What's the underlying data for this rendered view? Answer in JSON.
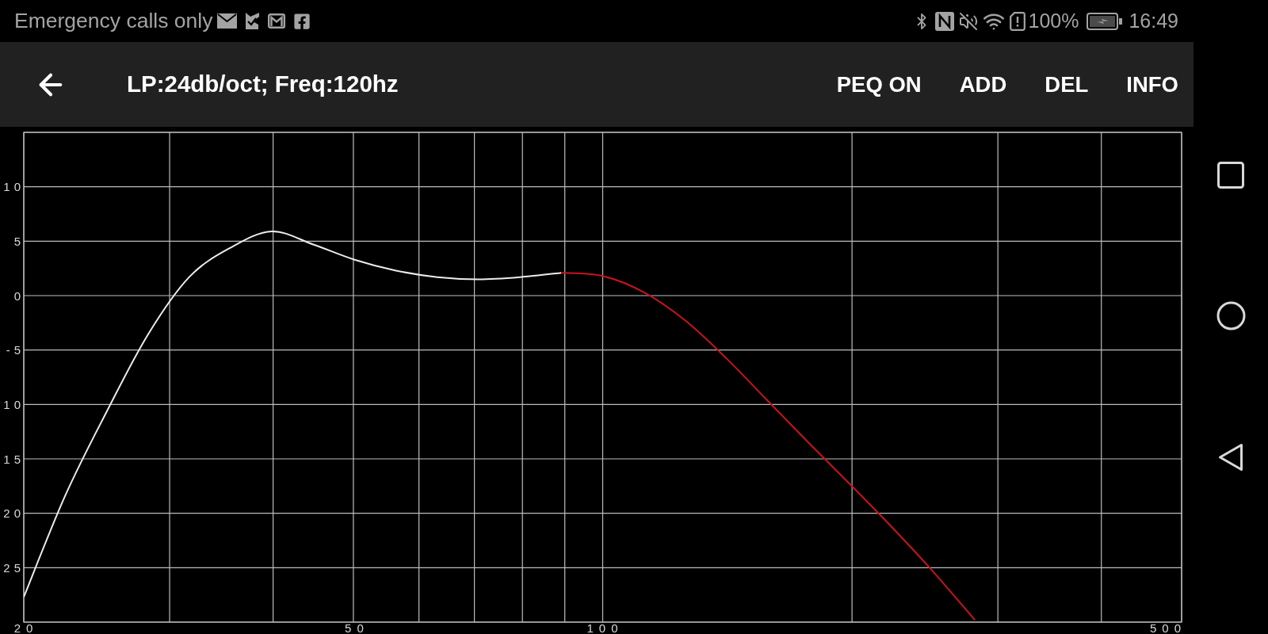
{
  "status_bar": {
    "carrier": "Emergency calls only",
    "battery": "100%",
    "time": "16:49"
  },
  "toolbar": {
    "title": "LP:24db/oct; Freq:120hz",
    "actions": [
      "PEQ ON",
      "ADD",
      "DEL",
      "INFO"
    ]
  },
  "graph": {
    "chart_data": {
      "type": "line",
      "grid": true,
      "categories": [
        "20",
        null,
        null,
        null,
        null,
        null,
        null,
        null,
        "50",
        null,
        null,
        null,
        null,
        null,
        "100",
        null,
        null,
        null,
        null,
        null,
        null,
        null,
        null,
        null,
        null,
        null,
        null,
        null,
        "500"
      ],
      "series": [
        {
          "color": "#ececec",
          "values": [
            -27.7,
            -18.4,
            -10.7,
            -3.6,
            1.7,
            4.4,
            5.9,
            4.7,
            3.3,
            2.3,
            1.7,
            1.5,
            1.7,
            2.1,
            null,
            null,
            null,
            null,
            null,
            null,
            null,
            null,
            null,
            null,
            null,
            null,
            null,
            null,
            null
          ]
        },
        {
          "color": "#c8141c",
          "values": [
            null,
            null,
            null,
            null,
            null,
            null,
            null,
            null,
            null,
            null,
            null,
            null,
            null,
            2.1,
            1.8,
            0.3,
            -2.3,
            -5.8,
            -9.7,
            -13.6,
            -17.4,
            -21.3,
            -25.4,
            -29.8,
            null,
            null,
            null,
            null,
            null
          ]
        }
      ],
      "ylim": [
        -30,
        15
      ],
      "yticks": [
        10,
        5,
        0,
        -5,
        {
          "value": -10,
          "label": "10"
        },
        {
          "value": -15,
          "label": "15"
        },
        {
          "value": -20,
          "label": "20"
        },
        {
          "value": -25,
          "label": "25"
        }
      ]
    }
  }
}
